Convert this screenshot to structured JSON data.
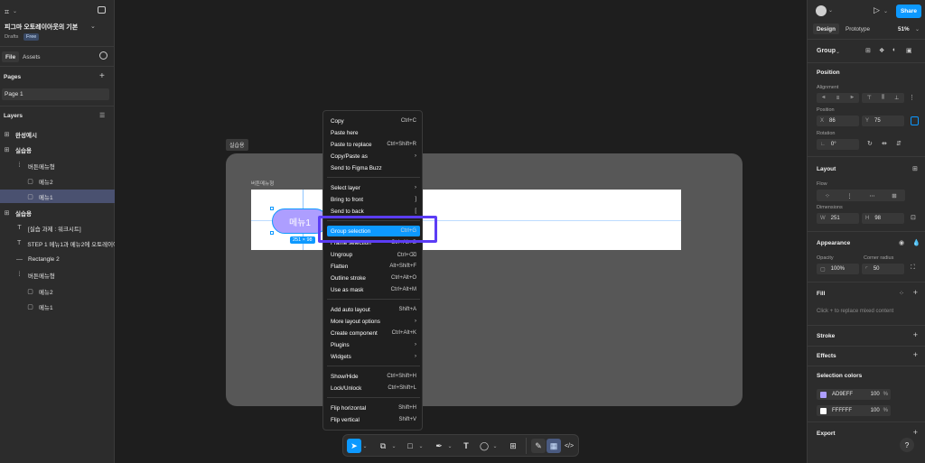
{
  "file": {
    "title": "피그마 오토레이아웃의 기본",
    "drafts": "Drafts",
    "badge": "Free"
  },
  "left_tabs": {
    "file": "File",
    "assets": "Assets"
  },
  "pages": {
    "heading": "Pages",
    "items": [
      "Page 1"
    ]
  },
  "layers": {
    "heading": "Layers",
    "items": [
      {
        "label": "완성예시",
        "icon": "frame-icon"
      },
      {
        "label": "실습용",
        "icon": "frame-icon"
      },
      {
        "label": "버튼메뉴형",
        "icon": "autolayout-icon"
      },
      {
        "label": "메뉴2",
        "icon": "rect-icon"
      },
      {
        "label": "메뉴1",
        "icon": "rect-icon"
      },
      {
        "label": "실습용",
        "icon": "frame-icon"
      },
      {
        "label": "[실습 과제 : 워크시트]",
        "icon": "text-icon"
      },
      {
        "label": "STEP 1 메뉴1과 메뉴2에 오토레이아웃",
        "icon": "text-icon"
      },
      {
        "label": "Rectangle 2",
        "icon": "line-icon"
      },
      {
        "label": "버튼메뉴형",
        "icon": "autolayout-icon"
      },
      {
        "label": "메뉴2",
        "icon": "rect-icon"
      },
      {
        "label": "메뉴1",
        "icon": "rect-icon"
      }
    ]
  },
  "canvas": {
    "frame_label": "실습용",
    "inner_label": "버튼메뉴형",
    "button_text": "메뉴1",
    "size_badge": "251 × 98"
  },
  "context_menu": {
    "groups": [
      [
        {
          "label": "Copy",
          "shortcut": "Ctrl+C"
        },
        {
          "label": "Paste here",
          "shortcut": ""
        },
        {
          "label": "Paste to replace",
          "shortcut": "Ctrl+Shift+R"
        },
        {
          "label": "Copy/Paste as",
          "shortcut": "›"
        },
        {
          "label": "Send to Figma Buzz",
          "shortcut": ""
        }
      ],
      [
        {
          "label": "Select layer",
          "shortcut": "›"
        },
        {
          "label": "Bring to front",
          "shortcut": "]"
        },
        {
          "label": "Send to back",
          "shortcut": "["
        }
      ],
      [
        {
          "label": "Group selection",
          "shortcut": "Ctrl+G"
        },
        {
          "label": "Frame selection",
          "shortcut": "Ctrl+Alt+G"
        },
        {
          "label": "Ungroup",
          "shortcut": "Ctrl+⌫"
        },
        {
          "label": "Flatten",
          "shortcut": "Alt+Shift+F"
        },
        {
          "label": "Outline stroke",
          "shortcut": "Ctrl+Alt+O"
        },
        {
          "label": "Use as mask",
          "shortcut": "Ctrl+Alt+M"
        }
      ],
      [
        {
          "label": "Add auto layout",
          "shortcut": "Shift+A"
        },
        {
          "label": "More layout options",
          "shortcut": "›"
        },
        {
          "label": "Create component",
          "shortcut": "Ctrl+Alt+K"
        },
        {
          "label": "Plugins",
          "shortcut": "›"
        },
        {
          "label": "Widgets",
          "shortcut": "›"
        }
      ],
      [
        {
          "label": "Show/Hide",
          "shortcut": "Ctrl+Shift+H"
        },
        {
          "label": "Lock/Unlock",
          "shortcut": "Ctrl+Shift+L"
        }
      ],
      [
        {
          "label": "Flip horizontal",
          "shortcut": "Shift+H"
        },
        {
          "label": "Flip vertical",
          "shortcut": "Shift+V"
        }
      ]
    ],
    "highlighted": "Group selection"
  },
  "right_panel": {
    "share": "Share",
    "tabs": {
      "design": "Design",
      "prototype": "Prototype",
      "zoom": "51%"
    },
    "selection_type": "Group",
    "position": {
      "heading": "Position",
      "alignment": "Alignment",
      "position_label": "Position",
      "x_label": "X",
      "x": "86",
      "y_label": "Y",
      "y": "75",
      "rotation_label": "Rotation",
      "rotation": "0°"
    },
    "layout": {
      "heading": "Layout",
      "flow": "Flow",
      "dimensions": "Dimensions",
      "w_label": "W",
      "w": "251",
      "h_label": "H",
      "h": "98"
    },
    "appearance": {
      "heading": "Appearance",
      "opacity_label": "Opacity",
      "opacity": "100%",
      "radius_label": "Corner radius",
      "radius": "50"
    },
    "fill": {
      "heading": "Fill",
      "hint": "Click + to replace mixed content"
    },
    "stroke": "Stroke",
    "effects": "Effects",
    "selection_colors": {
      "heading": "Selection colors",
      "items": [
        {
          "hex": "AD9EFF",
          "color": "#AD9EFF",
          "opacity": "100",
          "unit": "%"
        },
        {
          "hex": "FFFFFF",
          "color": "#FFFFFF",
          "opacity": "100",
          "unit": "%"
        }
      ]
    },
    "export": "Export",
    "help": "?"
  },
  "colors": {
    "accent": "#0d99ff",
    "highlight_box": "#5b3df5",
    "button_fill": "#AD9EFF"
  }
}
